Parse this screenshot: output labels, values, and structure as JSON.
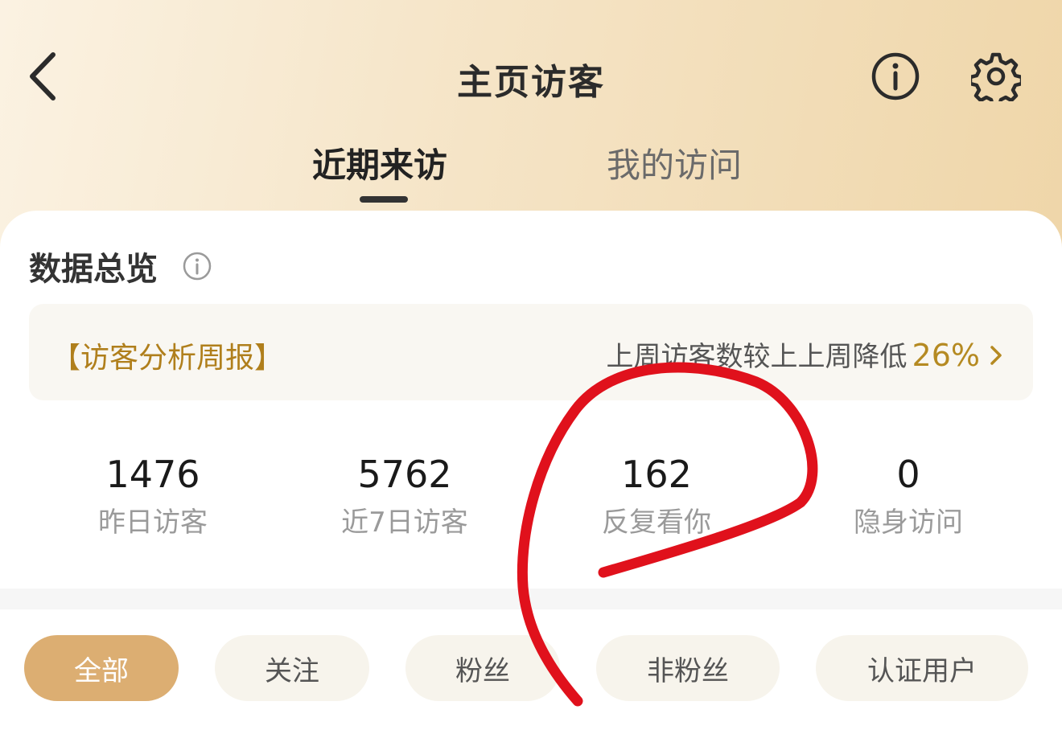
{
  "header": {
    "title": "主页访客",
    "tabs": [
      {
        "label": "近期来访",
        "active": true
      },
      {
        "label": "我的访问",
        "active": false
      }
    ],
    "icons": [
      "back-arrow-icon",
      "info-icon",
      "settings-gear-icon"
    ]
  },
  "overview": {
    "title": "数据总览",
    "report": {
      "label": "【访客分析周报】",
      "summary": "上周访客数较上上周降低",
      "change": "26%"
    },
    "stats": [
      {
        "value": "1476",
        "label": "昨日访客"
      },
      {
        "value": "5762",
        "label": "近7日访客"
      },
      {
        "value": "162",
        "label": "反复看你"
      },
      {
        "value": "0",
        "label": "隐身访问"
      }
    ]
  },
  "filters": [
    {
      "label": "全部",
      "active": true
    },
    {
      "label": "关注",
      "active": false
    },
    {
      "label": "粉丝",
      "active": false
    },
    {
      "label": "非粉丝",
      "active": false
    },
    {
      "label": "认证用户",
      "active": false
    }
  ],
  "colors": {
    "accent_gold": "#b07f1c",
    "active_chip": "#dcae72",
    "annotation_red": "#e0111c"
  }
}
